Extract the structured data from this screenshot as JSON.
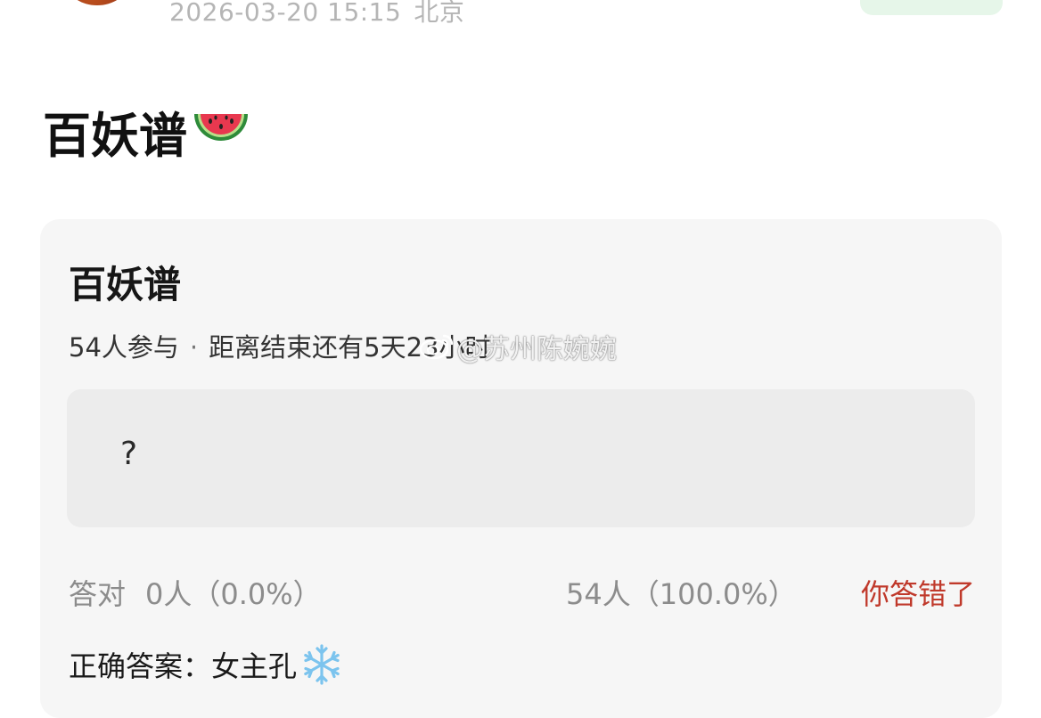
{
  "post": {
    "timestamp": "2026-03-20 15:15",
    "location": "北京",
    "title": "百妖谱",
    "title_emoji": "watermelon-icon"
  },
  "poll": {
    "title": "百妖谱",
    "participants": "54人参与",
    "separator": "·",
    "deadline": "距离结束还有5天23小时",
    "option_text": "?",
    "correct_label": "答对",
    "correct_count": "0人（0.0%）",
    "wrong_count": "54人（100.0%）",
    "verdict": "你答错了",
    "answer_label": "正确答案：",
    "answer_value": "女主孔",
    "answer_emoji": "snowflake-icon"
  },
  "watermark": {
    "text": "@苏州陈婉婉",
    "icon": "weibo-icon"
  },
  "colors": {
    "card_bg": "#f6f6f6",
    "option_bg": "#ececec",
    "verdict_red": "#c0392b",
    "follow_green": "#e6f6e9",
    "meta_gray": "#b5b5b5"
  }
}
